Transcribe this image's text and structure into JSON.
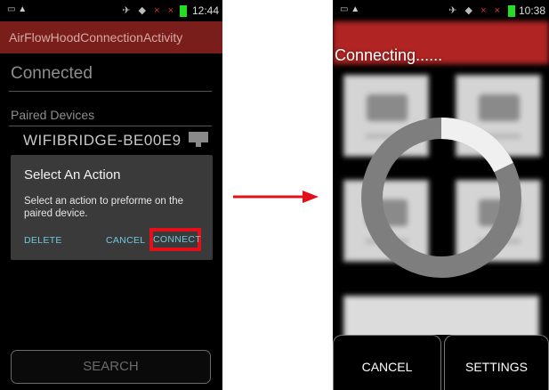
{
  "left_screen": {
    "status_bar": {
      "time": "12:44"
    },
    "activity_title": "AirFlowHoodConnectionActivity",
    "connection_status": "Connected",
    "paired_devices_header": "Paired Devices",
    "device": {
      "name": "WIFIBRIDGE-BE00E9",
      "icon": "device-chip-icon"
    },
    "dialog": {
      "title": "Select An Action",
      "message": "Select an action to preforme on the paired device.",
      "buttons": {
        "delete": "DELETE",
        "cancel": "CANCEL",
        "connect": "CONNECT"
      }
    },
    "search_button": "SEARCH"
  },
  "right_screen": {
    "status_bar": {
      "time": "10:38"
    },
    "progress_title": "Connecting......",
    "buttons": {
      "cancel": "CANCEL",
      "settings": "SETTINGS"
    }
  },
  "annotations": {
    "arrow_color": "#e3101a",
    "highlight_color": "#e3101a"
  },
  "colors": {
    "action_bar": "#7a1e1c",
    "dialog_button": "#6fc9dd",
    "battery": "#22e022"
  }
}
